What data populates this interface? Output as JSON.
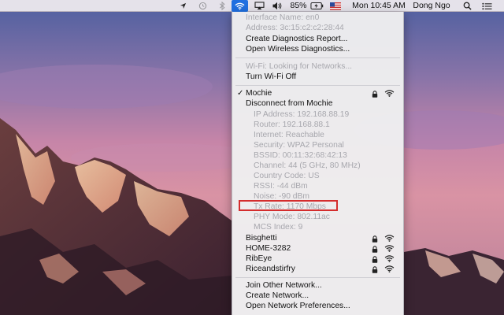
{
  "menubar": {
    "battery_percent": "85%",
    "clock": "Mon 10:45 AM",
    "user": "Dong Ngo",
    "icons": [
      "location-icon",
      "time-machine-icon",
      "bluetooth-icon",
      "wifi-icon",
      "airplay-icon",
      "volume-icon",
      "battery-icon",
      "flag-icon",
      "search-icon",
      "notification-center-icon"
    ]
  },
  "wifi_menu": {
    "interface_name": "Interface Name: en0",
    "address": "Address: 3c:15:c2:c2:28:44",
    "create_diagnostics": "Create Diagnostics Report...",
    "open_wireless_diagnostics": "Open Wireless Diagnostics...",
    "wifi_status": "Wi-Fi: Looking for Networks...",
    "turn_wifi_off": "Turn Wi-Fi Off",
    "current_network": {
      "name": "Mochie",
      "checkmark": "✓",
      "disconnect": "Disconnect from Mochie",
      "details": [
        "IP Address: 192.168.88.19",
        "Router: 192.168.88.1",
        "Internet: Reachable",
        "Security: WPA2 Personal",
        "BSSID: 00:11:32:68:42:13",
        "Channel: 44 (5 GHz, 80 MHz)",
        "Country Code: US",
        "RSSI: -44 dBm",
        "Noise: -90 dBm",
        "Tx Rate: 1170 Mbps",
        "PHY Mode: 802.11ac",
        "MCS Index: 9"
      ]
    },
    "other_networks": [
      "Bisghetti",
      "HOME-3282",
      "RibEye",
      "Riceandstirfry"
    ],
    "join_other": "Join Other Network...",
    "create_network": "Create Network...",
    "open_preferences": "Open Network Preferences..."
  },
  "colors": {
    "selected_highlight": "#1f6fe0",
    "annotation_box": "#d42d2d",
    "disabled_text": "#a7a7ad"
  }
}
